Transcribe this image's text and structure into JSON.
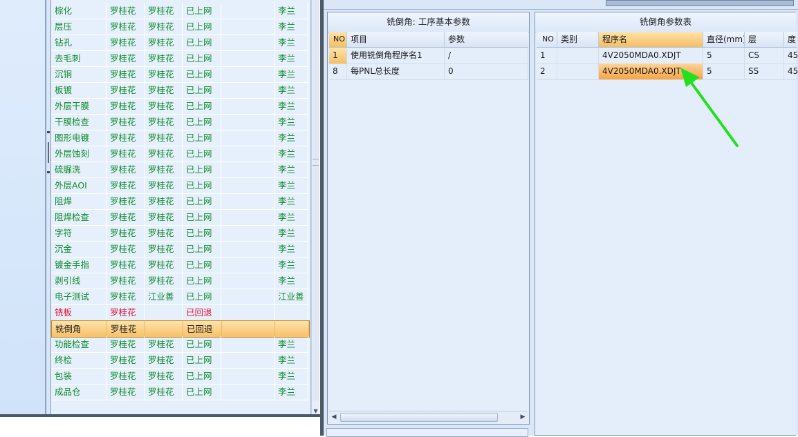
{
  "process_grid": {
    "rows": [
      {
        "c1": "棕化",
        "c2": "罗桂花",
        "c3": "罗桂花",
        "c4": "已上网",
        "c5": "",
        "c6": "李兰",
        "status": "green"
      },
      {
        "c1": "层压",
        "c2": "罗桂花",
        "c3": "罗桂花",
        "c4": "已上网",
        "c5": "",
        "c6": "李兰",
        "status": "green"
      },
      {
        "c1": "钻孔",
        "c2": "罗桂花",
        "c3": "罗桂花",
        "c4": "已上网",
        "c5": "",
        "c6": "李兰",
        "status": "green"
      },
      {
        "c1": "去毛刺",
        "c2": "罗桂花",
        "c3": "罗桂花",
        "c4": "已上网",
        "c5": "",
        "c6": "李兰",
        "status": "green"
      },
      {
        "c1": "沉铜",
        "c2": "罗桂花",
        "c3": "罗桂花",
        "c4": "已上网",
        "c5": "",
        "c6": "李兰",
        "status": "green"
      },
      {
        "c1": "板镀",
        "c2": "罗桂花",
        "c3": "罗桂花",
        "c4": "已上网",
        "c5": "",
        "c6": "李兰",
        "status": "green"
      },
      {
        "c1": "外层干膜",
        "c2": "罗桂花",
        "c3": "罗桂花",
        "c4": "已上网",
        "c5": "",
        "c6": "李兰",
        "status": "green"
      },
      {
        "c1": "干膜检查",
        "c2": "罗桂花",
        "c3": "罗桂花",
        "c4": "已上网",
        "c5": "",
        "c6": "李兰",
        "status": "green"
      },
      {
        "c1": "图形电镀",
        "c2": "罗桂花",
        "c3": "罗桂花",
        "c4": "已上网",
        "c5": "",
        "c6": "李兰",
        "status": "green"
      },
      {
        "c1": "外层蚀刻",
        "c2": "罗桂花",
        "c3": "罗桂花",
        "c4": "已上网",
        "c5": "",
        "c6": "李兰",
        "status": "green"
      },
      {
        "c1": "硫脲洗",
        "c2": "罗桂花",
        "c3": "罗桂花",
        "c4": "已上网",
        "c5": "",
        "c6": "李兰",
        "status": "green"
      },
      {
        "c1": "外层AOI",
        "c2": "罗桂花",
        "c3": "罗桂花",
        "c4": "已上网",
        "c5": "",
        "c6": "李兰",
        "status": "green"
      },
      {
        "c1": "阻焊",
        "c2": "罗桂花",
        "c3": "罗桂花",
        "c4": "已上网",
        "c5": "",
        "c6": "李兰",
        "status": "green"
      },
      {
        "c1": "阻焊检查",
        "c2": "罗桂花",
        "c3": "罗桂花",
        "c4": "已上网",
        "c5": "",
        "c6": "李兰",
        "status": "green"
      },
      {
        "c1": "字符",
        "c2": "罗桂花",
        "c3": "罗桂花",
        "c4": "已上网",
        "c5": "",
        "c6": "李兰",
        "status": "green"
      },
      {
        "c1": "沉金",
        "c2": "罗桂花",
        "c3": "罗桂花",
        "c4": "已上网",
        "c5": "",
        "c6": "李兰",
        "status": "green"
      },
      {
        "c1": "镀金手指",
        "c2": "罗桂花",
        "c3": "罗桂花",
        "c4": "已上网",
        "c5": "",
        "c6": "李兰",
        "status": "green"
      },
      {
        "c1": "剥引线",
        "c2": "罗桂花",
        "c3": "罗桂花",
        "c4": "已上网",
        "c5": "",
        "c6": "李兰",
        "status": "green"
      },
      {
        "c1": "电子测试",
        "c2": "罗桂花",
        "c3": "江业善",
        "c4": "已上网",
        "c5": "",
        "c6": "江业善",
        "status": "green"
      },
      {
        "c1": "铣板",
        "c2": "罗桂花",
        "c3": "",
        "c4": "已回退",
        "c5": "",
        "c6": "",
        "status": "red"
      },
      {
        "c1": "铣倒角",
        "c2": "罗桂花",
        "c3": "",
        "c4": "已回退",
        "c5": "",
        "c6": "",
        "status": "selected"
      },
      {
        "c1": "功能检查",
        "c2": "罗桂花",
        "c3": "罗桂花",
        "c4": "已上网",
        "c5": "",
        "c6": "李兰",
        "status": "green"
      },
      {
        "c1": "终检",
        "c2": "罗桂花",
        "c3": "罗桂花",
        "c4": "已上网",
        "c5": "",
        "c6": "李兰",
        "status": "green"
      },
      {
        "c1": "包装",
        "c2": "罗桂花",
        "c3": "罗桂花",
        "c4": "已上网",
        "c5": "",
        "c6": "李兰",
        "status": "green"
      },
      {
        "c1": "成品仓",
        "c2": "罗桂花",
        "c3": "罗桂花",
        "c4": "已上网",
        "c5": "",
        "c6": "李兰",
        "status": "green"
      }
    ]
  },
  "basic_params_panel": {
    "title": "铣倒角: 工序基本参数",
    "columns": [
      "NO",
      "项目",
      "参数"
    ],
    "rows": [
      {
        "no": "1",
        "item": "使用铣倒角程序名1",
        "value": "/"
      },
      {
        "no": "8",
        "item": "每PNL总长度",
        "value": "0"
      }
    ]
  },
  "param_table_panel": {
    "title": "铣倒角参数表",
    "columns": [
      "NO",
      "类别",
      "程序名",
      "直径(mm)",
      "层",
      "度"
    ],
    "rows": [
      {
        "no": "1",
        "category": "",
        "program": "4V2050MDA0.XDJT",
        "diameter": "5",
        "layer": "CS",
        "extra": "45"
      },
      {
        "no": "2",
        "category": "",
        "program": "4V2050MDA0.XDJT",
        "diameter": "5",
        "layer": "SS",
        "extra": "45"
      }
    ]
  },
  "annotation": {
    "arrow_color": "#22e01e"
  },
  "colors": {
    "ok": "#0f8a2a",
    "returned": "#e0102a",
    "selection": "#f7c169"
  }
}
